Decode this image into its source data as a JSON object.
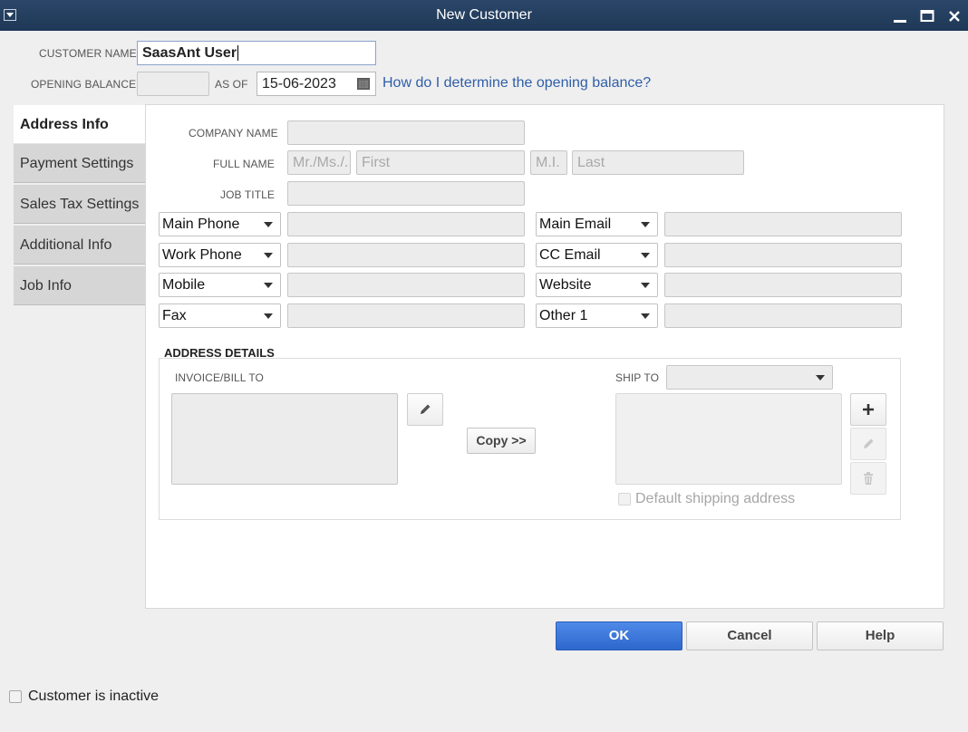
{
  "window": {
    "title": "New Customer"
  },
  "header": {
    "customer_name_label": "CUSTOMER NAME",
    "customer_name_value": "SaasAnt User",
    "opening_balance_label": "OPENING BALANCE",
    "opening_balance_value": "",
    "as_of_label": "AS OF",
    "as_of_value": "15-06-2023",
    "help_link": "How do I determine the opening balance?"
  },
  "tabs": [
    {
      "label": "Address Info",
      "active": true
    },
    {
      "label": "Payment Settings",
      "active": false
    },
    {
      "label": "Sales Tax Settings",
      "active": false
    },
    {
      "label": "Additional Info",
      "active": false
    },
    {
      "label": "Job Info",
      "active": false
    }
  ],
  "address_info": {
    "company_name_label": "COMPANY NAME",
    "full_name_label": "FULL NAME",
    "full_name_placeholders": {
      "salutation": "Mr./Ms./...",
      "first": "First",
      "mi": "M.I.",
      "last": "Last"
    },
    "job_title_label": "JOB TITLE",
    "phone_selectors": [
      "Main Phone",
      "Work Phone",
      "Mobile",
      "Fax"
    ],
    "email_selectors": [
      "Main Email",
      "CC Email",
      "Website",
      "Other 1"
    ]
  },
  "address_details": {
    "section_title": "ADDRESS DETAILS",
    "bill_to_label": "INVOICE/BILL TO",
    "copy_button": "Copy >>",
    "ship_to_label": "SHIP TO",
    "ship_to_value": "",
    "default_shipping_label": "Default shipping address"
  },
  "footer": {
    "ok": "OK",
    "cancel": "Cancel",
    "help": "Help",
    "inactive_label": "Customer is inactive"
  },
  "colors": {
    "titlebar": "#233d5d",
    "ok_button": "#3a74d8",
    "link": "#2f5ea8"
  }
}
